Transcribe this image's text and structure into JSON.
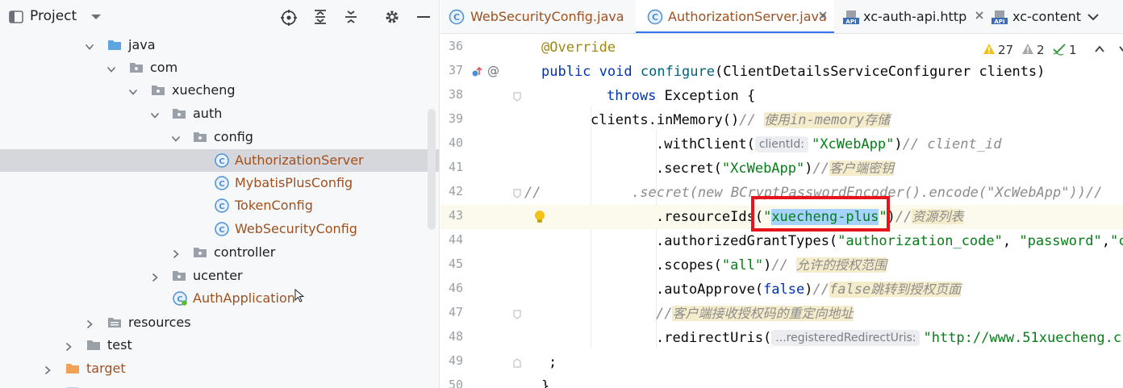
{
  "project_panel": {
    "title": "Project",
    "tree": [
      {
        "label": "java",
        "kind": "folder-blue",
        "expanded": true
      },
      {
        "label": "com",
        "kind": "package",
        "expanded": true
      },
      {
        "label": "xuecheng",
        "kind": "package",
        "expanded": true
      },
      {
        "label": "auth",
        "kind": "package",
        "expanded": true
      },
      {
        "label": "config",
        "kind": "package",
        "expanded": true
      },
      {
        "label": "AuthorizationServer",
        "kind": "class",
        "selected": true
      },
      {
        "label": "MybatisPlusConfig",
        "kind": "class"
      },
      {
        "label": "TokenConfig",
        "kind": "class"
      },
      {
        "label": "WebSecurityConfig",
        "kind": "class"
      },
      {
        "label": "controller",
        "kind": "package",
        "expanded": false
      },
      {
        "label": "ucenter",
        "kind": "package",
        "expanded": false
      },
      {
        "label": "AuthApplication",
        "kind": "spring-class"
      },
      {
        "label": "resources",
        "kind": "folder-res",
        "expanded": false
      },
      {
        "label": "test",
        "kind": "folder-gray",
        "expanded": false
      },
      {
        "label": "target",
        "kind": "folder-orange",
        "expanded": false
      }
    ]
  },
  "tabs": [
    {
      "label": "WebSecurityConfig.java",
      "icon": "class-icon",
      "active": false
    },
    {
      "label": "AuthorizationServer.java",
      "icon": "class-icon",
      "active": true
    },
    {
      "label": "xc-auth-api.http",
      "icon": "api-icon",
      "active": false
    },
    {
      "label": "xc-content",
      "icon": "api-icon",
      "active": false
    }
  ],
  "inspections": {
    "warnings": "27",
    "weak_warnings": "2",
    "typos": "1"
  },
  "editor": {
    "line_numbers": [
      "36",
      "37",
      "38",
      "39",
      "40",
      "41",
      "42",
      "43",
      "44",
      "45",
      "46",
      "47",
      "48",
      "49",
      "50"
    ],
    "code": {
      "l36_anno": "@Override",
      "l37_kw1": "public",
      "l37_kw2": "void",
      "l37_fn": "configure",
      "l37_rest": "(ClientDetailsServiceConfigurer clients)",
      "l38_kw": "throws",
      "l38_rest": " Exception {",
      "l39_code": "clients.inMemory()",
      "l39_cmt1": "// ",
      "l39_cmt2": "使用",
      "l39_cmt3": "in-memory",
      "l39_cmt4": "存储",
      "l40_code": ".withClient(",
      "l40_hint": "clientId:",
      "l40_str": "\"XcWebApp\"",
      "l40_paren": ")",
      "l40_cmt": "// client_id",
      "l41_code": ".secret(",
      "l41_str": "\"XcWebApp\"",
      "l41_paren": ")",
      "l41_cmt1": "//",
      "l41_cmt2": "客户端密钥",
      "l42_cmt": "//           .secret(new BCryptPasswordEncoder().encode(\"XcWebApp\"))//",
      "l43_code": ".resourceIds(",
      "l43_q1": "\"",
      "l43_sel": "xuecheng-plus",
      "l43_q2": "\"",
      "l43_paren": ")",
      "l43_cmt1": "//",
      "l43_cmt2": "资源列表",
      "l44_code": ".authorizedGrantTypes(",
      "l44_str1": "\"authorization_code\"",
      "l44_sep1": ", ",
      "l44_str2": "\"password\"",
      "l44_sep2": ",",
      "l44_str3": "\"cl",
      "l45_code": ".scopes(",
      "l45_str": "\"all\"",
      "l45_paren": ")",
      "l45_cmt1": "// ",
      "l45_cmt2": "允许的授权范围",
      "l46_code": ".autoApprove(",
      "l46_kw": "false",
      "l46_paren": ")",
      "l46_cmt1": "//",
      "l46_cmt2": "false",
      "l46_cmt3": "跳转到授权页面",
      "l47_cmt1": "//",
      "l47_cmt2": "客户端接收授权码的重定向地址",
      "l48_code": ".redirectUris(",
      "l48_hint": "...registeredRedirectUris:",
      "l48_str": "\"http://www.51xuecheng.c",
      "l49_code": ";",
      "l50_code": "}"
    }
  },
  "colors": {
    "selection_bg": "#d5d7dc",
    "accent": "#3574f0",
    "highlight_box": "#e8141b"
  }
}
